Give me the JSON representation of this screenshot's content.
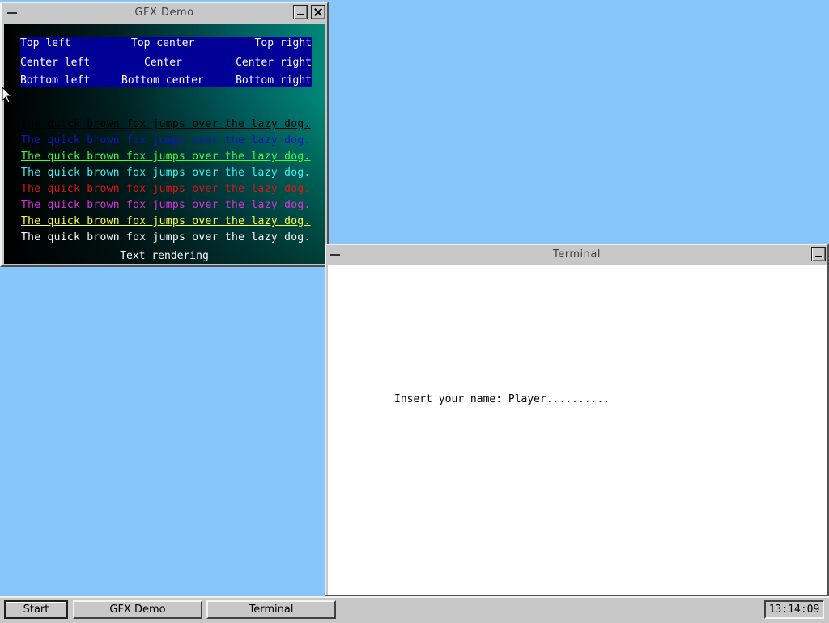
{
  "gfx_window": {
    "title": "GFX Demo",
    "alignment_labels": {
      "top_left": "Top left",
      "top_center": "Top center",
      "top_right": "Top right",
      "center_left": "Center left",
      "center": "Center",
      "center_right": "Center right",
      "bottom_left": "Bottom left",
      "bottom_center": "Bottom center",
      "bottom_right": "Bottom right"
    },
    "sample_lines": [
      {
        "text": "The quick brown fox jumps over the lazy dog.",
        "color": "#000000",
        "underline": true
      },
      {
        "text": "The quick brown fox jumps over the lazy dog.",
        "color": "#1414c8",
        "underline": false
      },
      {
        "text": "The quick brown fox jumps over the lazy dog.",
        "color": "#3cff3c",
        "underline": true
      },
      {
        "text": "The quick brown fox jumps over the lazy dog.",
        "color": "#46f0f0",
        "underline": false
      },
      {
        "text": "The quick brown fox jumps over the lazy dog.",
        "color": "#e11414",
        "underline": true
      },
      {
        "text": "The quick brown fox jumps over the lazy dog.",
        "color": "#dc32dc",
        "underline": false
      },
      {
        "text": "The quick brown fox jumps over the lazy dog.",
        "color": "#ffff46",
        "underline": true
      },
      {
        "text": "The quick brown fox jumps over the lazy dog.",
        "color": "#ffffff",
        "underline": false
      }
    ],
    "caption": "Text rendering"
  },
  "terminal_window": {
    "title": "Terminal",
    "prompt_line": "Insert your name: Player.........."
  },
  "taskbar": {
    "start_label": "Start",
    "tasks": [
      "GFX Demo",
      "Terminal"
    ],
    "clock": "13:14:09"
  },
  "colors": {
    "desktop": "#87c6fa",
    "chrome": "#c8c8c8",
    "align_panel": "#000096"
  }
}
